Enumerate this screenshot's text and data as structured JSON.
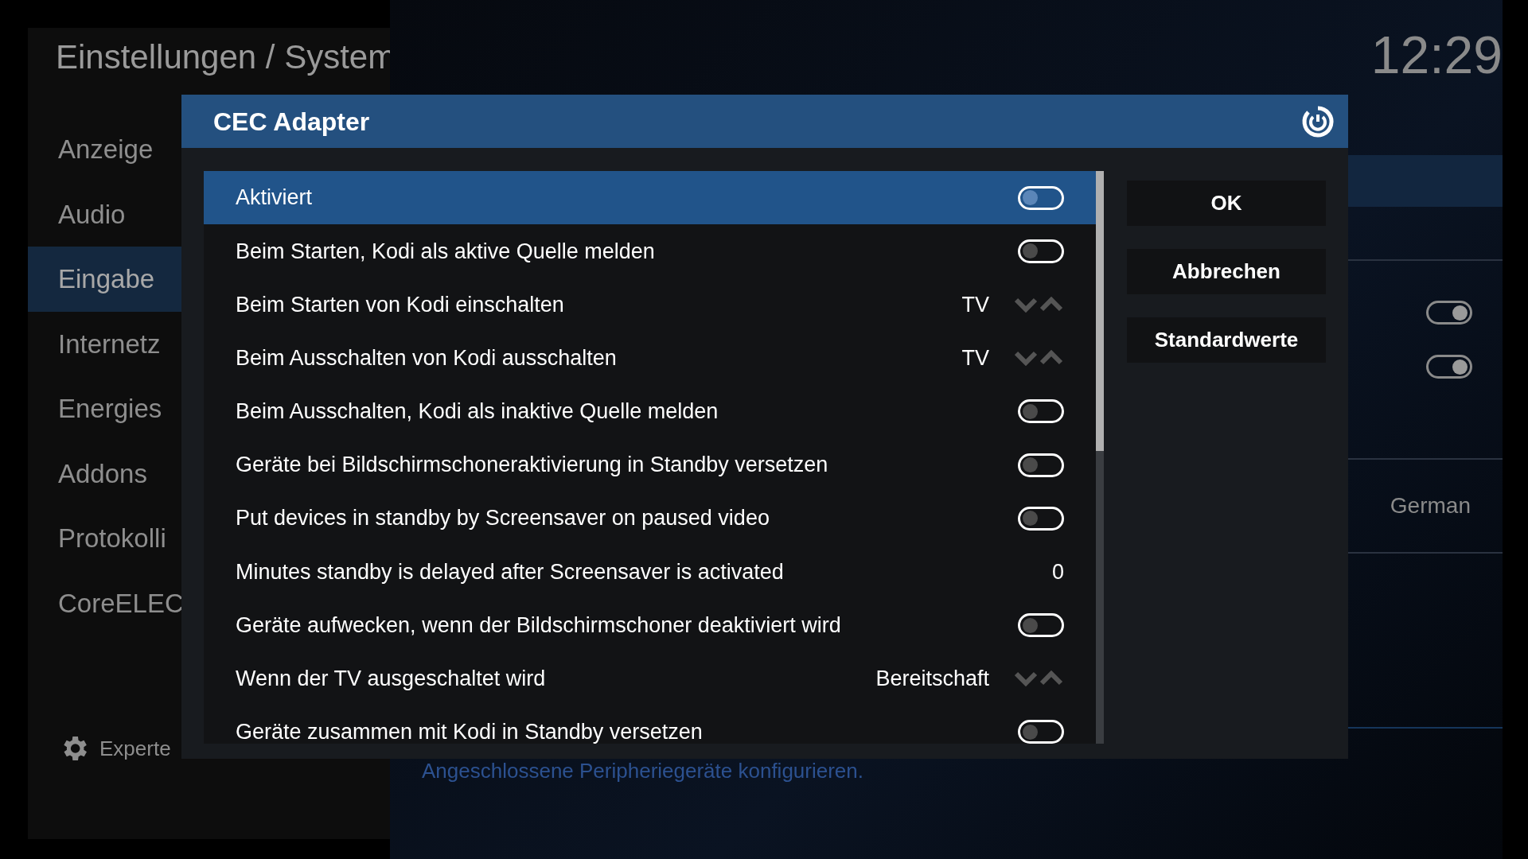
{
  "header": {
    "title": "Einstellungen / System",
    "clock": "12:29"
  },
  "sidebar": {
    "items": [
      {
        "label": "Anzeige",
        "selected": false
      },
      {
        "label": "Audio",
        "selected": false
      },
      {
        "label": "Eingabe",
        "selected": true
      },
      {
        "label": "Internetz",
        "selected": false
      },
      {
        "label": "Energies",
        "selected": false
      },
      {
        "label": "Addons",
        "selected": false
      },
      {
        "label": "Protokolli",
        "selected": false
      },
      {
        "label": "CoreELEC",
        "selected": false
      }
    ],
    "level_button": "Experte"
  },
  "background": {
    "toggles": [
      {
        "on": true
      },
      {
        "on": true
      }
    ],
    "language_value": "German",
    "description": "Angeschlossene Peripheriegeräte konfigurieren."
  },
  "dialog": {
    "title": "CEC Adapter",
    "settings": [
      {
        "kind": "toggle",
        "label": "Aktiviert",
        "on": false,
        "selected": true
      },
      {
        "kind": "toggle",
        "label": "Beim Starten, Kodi als aktive Quelle melden",
        "on": false,
        "selected": false
      },
      {
        "kind": "spinner",
        "label": "Beim Starten von Kodi einschalten",
        "value": "TV",
        "selected": false
      },
      {
        "kind": "spinner",
        "label": "Beim Ausschalten von Kodi ausschalten",
        "value": "TV",
        "selected": false
      },
      {
        "kind": "toggle",
        "label": "Beim Ausschalten, Kodi als inaktive Quelle melden",
        "on": false,
        "selected": false
      },
      {
        "kind": "toggle",
        "label": "Geräte bei Bildschirmschoneraktivierung in Standby versetzen",
        "on": false,
        "selected": false
      },
      {
        "kind": "toggle",
        "label": "Put devices in standby by Screensaver on paused video",
        "on": false,
        "selected": false
      },
      {
        "kind": "value",
        "label": "Minutes standby is delayed after Screensaver is activated",
        "value": "0",
        "selected": false
      },
      {
        "kind": "toggle",
        "label": "Geräte aufwecken, wenn der Bildschirmschoner deaktiviert wird",
        "on": false,
        "selected": false
      },
      {
        "kind": "spinner",
        "label": "Wenn der TV ausgeschaltet wird",
        "value": "Bereitschaft",
        "selected": false
      },
      {
        "kind": "toggle",
        "label": "Geräte zusammen mit Kodi in Standby versetzen",
        "on": false,
        "selected": false
      }
    ],
    "buttons": [
      "OK",
      "Abbrechen",
      "Standardwerte"
    ]
  }
}
